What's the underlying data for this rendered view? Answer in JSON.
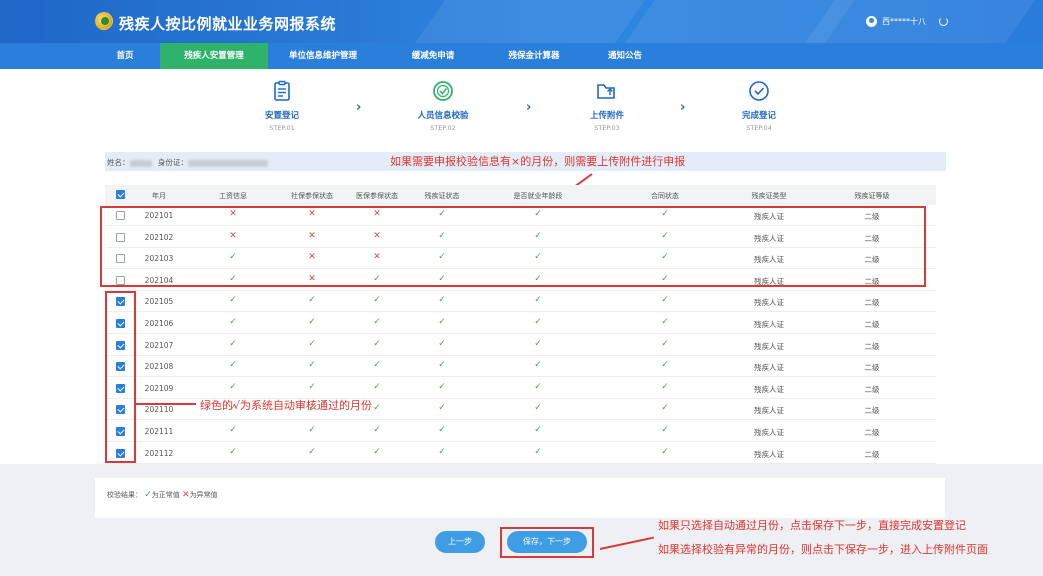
{
  "app": {
    "title": "残疾人按比例就业业务网报系统",
    "user": "西*****十八"
  },
  "nav": [
    {
      "label": "首页",
      "active": false
    },
    {
      "label": "残疾人安置管理",
      "active": true
    },
    {
      "label": "单位信息维护管理",
      "active": false
    },
    {
      "label": "缓减免申请",
      "active": false
    },
    {
      "label": "残保金计算器",
      "active": false
    },
    {
      "label": "通知公告",
      "active": false
    }
  ],
  "steps": [
    {
      "label": "安置登记",
      "sub": "STEP.01",
      "icon": "clipboard-icon"
    },
    {
      "label": "人员信息校验",
      "sub": "STEP.02",
      "icon": "verify-badge-icon"
    },
    {
      "label": "上传附件",
      "sub": "STEP.03",
      "icon": "upload-folder-icon"
    },
    {
      "label": "完成登记",
      "sub": "STEP.04",
      "icon": "check-circle-icon"
    }
  ],
  "info": {
    "name_label": "姓名：",
    "id_label": "身份证："
  },
  "table": {
    "headers": [
      "年月",
      "工资信息",
      "社保参保状态",
      "医保参保状态",
      "残疾证状态",
      "是否就业年龄段",
      "合同状态",
      "残疾证类型",
      "残疾证等级"
    ],
    "rows": [
      {
        "month": "202101",
        "checked": false,
        "wage": "x",
        "social": "x",
        "medical": "x",
        "cert": "ok",
        "age": "ok",
        "contract": "ok",
        "type": "残疾人证",
        "level": "二级"
      },
      {
        "month": "202102",
        "checked": false,
        "wage": "x",
        "social": "x",
        "medical": "x",
        "cert": "ok",
        "age": "ok",
        "contract": "ok",
        "type": "残疾人证",
        "level": "二级"
      },
      {
        "month": "202103",
        "checked": false,
        "wage": "ok",
        "social": "x",
        "medical": "x",
        "cert": "ok",
        "age": "ok",
        "contract": "ok",
        "type": "残疾人证",
        "level": "二级"
      },
      {
        "month": "202104",
        "checked": false,
        "wage": "ok",
        "social": "x",
        "medical": "ok",
        "cert": "ok",
        "age": "ok",
        "contract": "ok",
        "type": "残疾人证",
        "level": "二级"
      },
      {
        "month": "202105",
        "checked": true,
        "wage": "ok",
        "social": "ok",
        "medical": "ok",
        "cert": "ok",
        "age": "ok",
        "contract": "ok",
        "type": "残疾人证",
        "level": "二级"
      },
      {
        "month": "202106",
        "checked": true,
        "wage": "ok",
        "social": "ok",
        "medical": "ok",
        "cert": "ok",
        "age": "ok",
        "contract": "ok",
        "type": "残疾人证",
        "level": "二级"
      },
      {
        "month": "202107",
        "checked": true,
        "wage": "ok",
        "social": "ok",
        "medical": "ok",
        "cert": "ok",
        "age": "ok",
        "contract": "ok",
        "type": "残疾人证",
        "level": "二级"
      },
      {
        "month": "202108",
        "checked": true,
        "wage": "ok",
        "social": "ok",
        "medical": "ok",
        "cert": "ok",
        "age": "ok",
        "contract": "ok",
        "type": "残疾人证",
        "level": "二级"
      },
      {
        "month": "202109",
        "checked": true,
        "wage": "ok",
        "social": "ok",
        "medical": "ok",
        "cert": "ok",
        "age": "ok",
        "contract": "ok",
        "type": "残疾人证",
        "level": "二级"
      },
      {
        "month": "202110",
        "checked": true,
        "wage": "ok",
        "social": "ok",
        "medical": "ok",
        "cert": "ok",
        "age": "ok",
        "contract": "ok",
        "type": "残疾人证",
        "level": "二级"
      },
      {
        "month": "202111",
        "checked": true,
        "wage": "ok",
        "social": "ok",
        "medical": "ok",
        "cert": "ok",
        "age": "ok",
        "contract": "ok",
        "type": "残疾人证",
        "level": "二级"
      },
      {
        "month": "202112",
        "checked": true,
        "wage": "ok",
        "social": "ok",
        "medical": "ok",
        "cert": "ok",
        "age": "ok",
        "contract": "ok",
        "type": "残疾人证",
        "level": "二级"
      }
    ]
  },
  "legend": {
    "label": "校验结果：",
    "ok_text": "为正常值",
    "bad_text": "为异常值"
  },
  "buttons": {
    "prev": "上一步",
    "save_next": "保存，下一步"
  },
  "annotations": {
    "top": "如果需要申报校验信息有×的月份，则需要上传附件进行申报",
    "middle": "绿色的√为系统自动审核通过的月份",
    "bottom1": "如果只选择自动通过月份，点击保存下一步，直接完成安置登记",
    "bottom2": "如果选择校验有异常的月份，则点击下保存一步，进入上传附件页面"
  },
  "colors": {
    "brand": "#2b7fdc",
    "active_nav": "#2fb36b",
    "ok": "#3daa4a",
    "bad": "#e24646",
    "annotation": "#e0342f"
  }
}
